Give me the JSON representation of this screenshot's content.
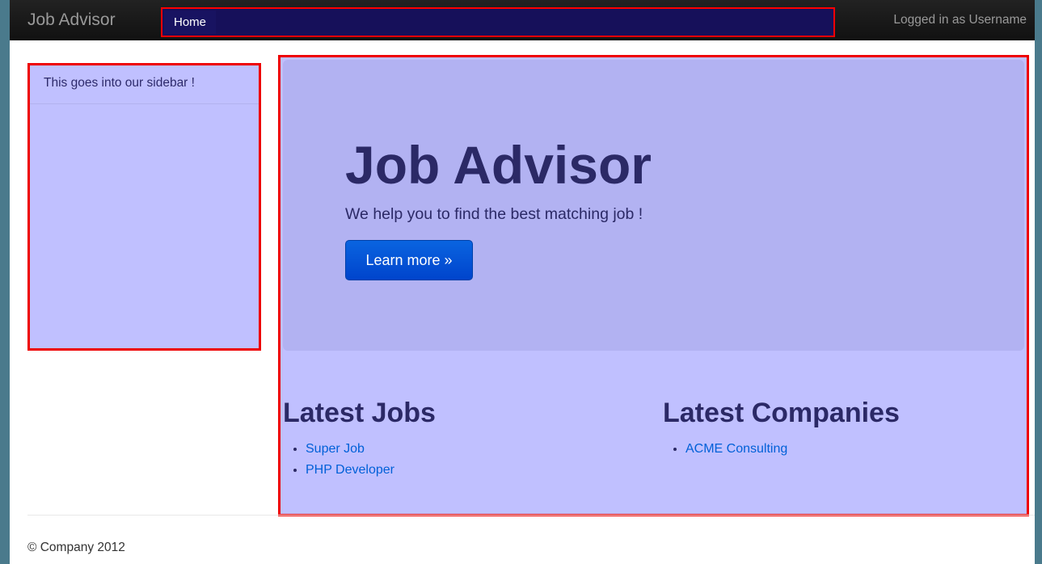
{
  "navbar": {
    "brand": "Job Advisor",
    "home_label": "Home",
    "logged_in_text": "Logged in as Username"
  },
  "sidebar": {
    "header_text": "This goes into our sidebar !"
  },
  "hero": {
    "title": "Job Advisor",
    "subtitle": "We help you to find the best matching job !",
    "button_label": "Learn more »"
  },
  "latest_jobs": {
    "heading": "Latest Jobs",
    "items": [
      {
        "label": "Super Job"
      },
      {
        "label": "PHP Developer"
      }
    ]
  },
  "latest_companies": {
    "heading": "Latest Companies",
    "items": [
      {
        "label": "ACME Consulting"
      }
    ]
  },
  "footer": {
    "copyright": "© Company 2012"
  },
  "colors": {
    "navbar_bg": "#1b1b1b",
    "panel_bg": "#c0c0ff",
    "hero_bg": "#b2b2f2",
    "highlight_border": "#ee0000",
    "button_bg": "#0055cc",
    "link": "#0060d8"
  }
}
